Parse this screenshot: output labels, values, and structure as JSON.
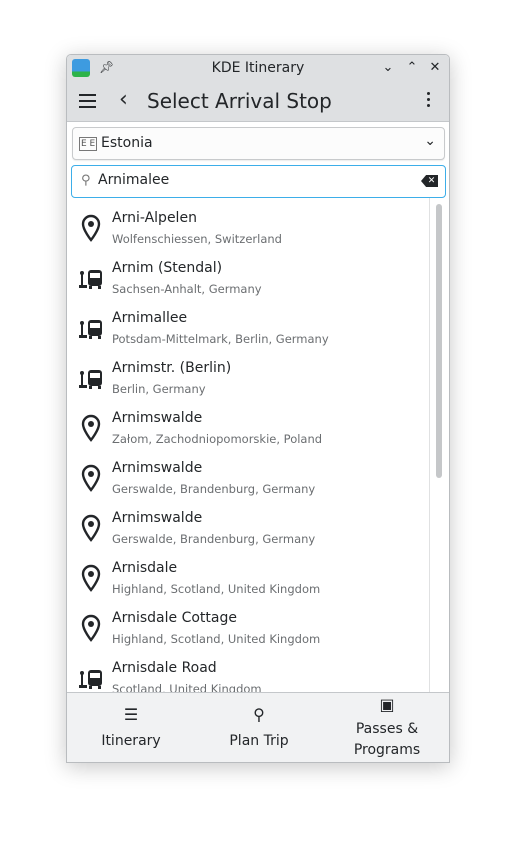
{
  "window": {
    "title": "KDE Itinerary"
  },
  "header": {
    "title": "Select Arrival Stop"
  },
  "country": {
    "value": "Estonia"
  },
  "search": {
    "value": "Arnimalee"
  },
  "results": [
    {
      "name": "Arni-Alpelen",
      "location": "Wolfenschiessen, Switzerland",
      "icon": "location-pin-icon"
    },
    {
      "name": "Arnim (Stendal)",
      "location": "Sachsen-Anhalt, Germany",
      "icon": "bus-stop-icon"
    },
    {
      "name": "Arnimallee",
      "location": "Potsdam-Mittelmark, Berlin, Germany",
      "icon": "bus-stop-icon"
    },
    {
      "name": "Arnimstr. (Berlin)",
      "location": "Berlin, Germany",
      "icon": "bus-stop-icon"
    },
    {
      "name": "Arnimswalde",
      "location": "Załom, Zachodniopomorskie, Poland",
      "icon": "location-pin-icon"
    },
    {
      "name": "Arnimswalde",
      "location": "Gerswalde, Brandenburg, Germany",
      "icon": "location-pin-icon"
    },
    {
      "name": "Arnimswalde",
      "location": "Gerswalde, Brandenburg, Germany",
      "icon": "location-pin-icon"
    },
    {
      "name": "Arnisdale",
      "location": "Highland, Scotland, United Kingdom",
      "icon": "location-pin-icon"
    },
    {
      "name": "Arnisdale Cottage",
      "location": "Highland, Scotland, United Kingdom",
      "icon": "location-pin-icon"
    },
    {
      "name": "Arnisdale Road",
      "location": "Scotland, United Kingdom",
      "icon": "bus-stop-icon"
    }
  ],
  "nav": [
    {
      "label": "Itinerary",
      "icon": "itinerary-list-icon"
    },
    {
      "label": "Plan Trip",
      "icon": "search-icon"
    },
    {
      "label": "Passes & Programs",
      "icon": "wallet-icon"
    }
  ],
  "colors": {
    "accent": "#3daee9",
    "toolbar": "#dee0e2",
    "text": "#232629"
  }
}
